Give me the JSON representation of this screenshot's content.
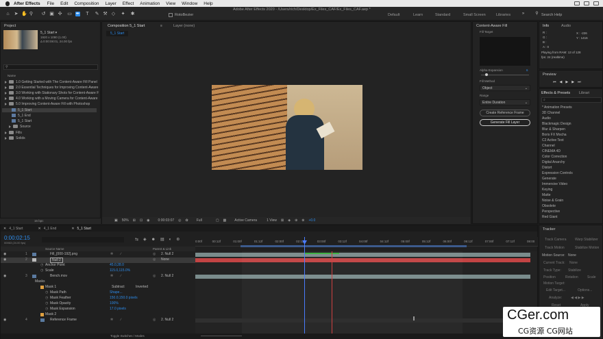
{
  "menubar": {
    "app_name": "After Effects",
    "items": [
      "File",
      "Edit",
      "Composition",
      "Layer",
      "Effect",
      "Animation",
      "View",
      "Window",
      "Help"
    ]
  },
  "toolbar": {
    "rotobezier_label": "RotoBezier",
    "window_title": "Adobe After Effects 2020 - /Users/rich/Desktop/Ex_Files_CAF/Ex_Files_CAF.aep *",
    "workspaces": [
      "Default",
      "Learn",
      "Standard",
      "Small Screen",
      "Libraries"
    ],
    "active_workspace": "Standard",
    "search_placeholder": "Search Help"
  },
  "project": {
    "title": "Project",
    "item_name": "5_1 Start ▾",
    "item_dims": "1920 x 1080 (1.00)",
    "item_duration": "Δ 0:00:08:01, 24.00 fps",
    "col_name": "Name",
    "tree": [
      "1.0 Getting Started with The Content-Aware Fill Panel",
      "2.0 Essential Techniques for Improving Content-Aware",
      "3.0 Working with Stationary Shots for Content-Aware F",
      "4.0 Working with a Moving Camera for Content-Aware",
      "5.0 Improving Content-Aware Fill with Photoshop",
      "5_1 Start",
      "5_1 End",
      "5_1 Start",
      "Source",
      "Fills",
      "Solids"
    ],
    "bpc": "16 bpc"
  },
  "composition": {
    "tab_label": "Composition 5_1 Start",
    "layer_tab": "Layer (none)",
    "sub_tab": "5_1 Start",
    "zoom": "50%",
    "timecode": "0:00:03:07",
    "resolution": "Full",
    "camera": "Active Camera",
    "views": "1 View",
    "exposure": "+0.0"
  },
  "caf": {
    "title": "Content-Aware Fill",
    "fill_target_label": "Fill Target",
    "alpha_expansion_label": "Alpha Expansion",
    "alpha_expansion_value": "6",
    "fill_method_label": "Fill Method",
    "fill_method": "Object",
    "range_label": "Range",
    "range": "Entire Duration",
    "create_ref_label": "Create Reference Frame",
    "generate_label": "Generate Fill Layer"
  },
  "info": {
    "tabs": [
      "Info",
      "Audio"
    ],
    "r": "R :",
    "g": "G :",
    "b": "B :",
    "a": "A : 0",
    "x": "X : -226",
    "y": "Y : 1416",
    "status1": "Playing from RAM: 13 of 128",
    "status2": "fps: 24 (realtime)"
  },
  "preview": {
    "title": "Preview"
  },
  "effects": {
    "tabs": [
      "Effects & Presets",
      "Librari"
    ],
    "search_placeholder": "⌕",
    "items": [
      "* Animation Presets",
      "3D Channel",
      "Audio",
      "Blackmagic Design",
      "Blur & Sharpen",
      "Boris FX Mocha",
      "C2 Active Text",
      "Channel",
      "CINEMA 4D",
      "Color Correction",
      "Digital Anarchy",
      "Distort",
      "Expression Controls",
      "Generate",
      "Immersive Video",
      "Keying",
      "Matte",
      "Noise & Grain",
      "Obsolete",
      "Perspective",
      "Red Giant"
    ]
  },
  "tracker": {
    "title": "Tracker",
    "buttons": [
      "Track Camera",
      "Warp Stabilizer",
      "Track Motion",
      "Stabilize Motion"
    ],
    "motion_source_label": "Motion Source:",
    "motion_source": "None",
    "current_track": "Current Track:",
    "current_track_value": "None",
    "track_type": "Track Type:",
    "track_type_value": "Stabilize",
    "options": [
      "Position",
      "Rotation",
      "Scale"
    ],
    "motion_target": "Motion Target:",
    "edit_target": "Edit Target...",
    "options_btn": "Options...",
    "analyze": "Analyze:",
    "reset": "Reset",
    "apply": "Apply"
  },
  "timeline": {
    "tabs": [
      "4_1 Start",
      "4_1 End",
      "5_1 Start"
    ],
    "active_tab": "5_1 Start",
    "timecode": "0:00:02:15",
    "frame_info": "00063 (24.00 fps)",
    "col_source": "Source Name",
    "col_parent": "Parent & Link",
    "ruler": [
      "0:00f",
      "00:12f",
      "01:00f",
      "01:12f",
      "02:00f",
      "02:12f",
      "03:00f",
      "03:12f",
      "04:00f",
      "04:12f",
      "05:00f",
      "05:12f",
      "06:00f",
      "06:12f",
      "07:00f",
      "07:12f",
      "08:00"
    ],
    "layers": [
      {
        "num": "1",
        "name": "Fill_[000-192].png",
        "parent": "2. Null 2"
      },
      {
        "num": "2",
        "name": "Null 2",
        "parent": "None"
      },
      {
        "prop": "Anchor Point",
        "value": "45.0,28.0"
      },
      {
        "prop": "Scale",
        "value": "115.0,115.0%"
      },
      {
        "num": "3",
        "name": "Bench.mov",
        "parent": "2. Null 2"
      },
      {
        "prop": "Masks"
      },
      {
        "prop": "Mask 1",
        "mode": "Subtract",
        "inverted": "Inverted"
      },
      {
        "prop": "Mask Path",
        "value": "Shape..."
      },
      {
        "prop": "Mask Feather",
        "value": "150.0,150.0 pixels"
      },
      {
        "prop": "Mask Opacity",
        "value": "100%"
      },
      {
        "prop": "Mask Expansion",
        "value": "17.0 pixels"
      },
      {
        "prop": "Mask 2"
      },
      {
        "num": "4",
        "name": "Reference Frame",
        "parent": "2. Null 2"
      }
    ],
    "toggle_label": "Toggle Switches / Modes"
  },
  "watermark": {
    "main": "CGer.com",
    "sub": "CG资源 CG网站"
  },
  "colors": {
    "accent": "#2d8ceb",
    "playhead": "#4a7cff",
    "null_bar": "#c24444",
    "layer_bar": "#7a8c8c"
  }
}
